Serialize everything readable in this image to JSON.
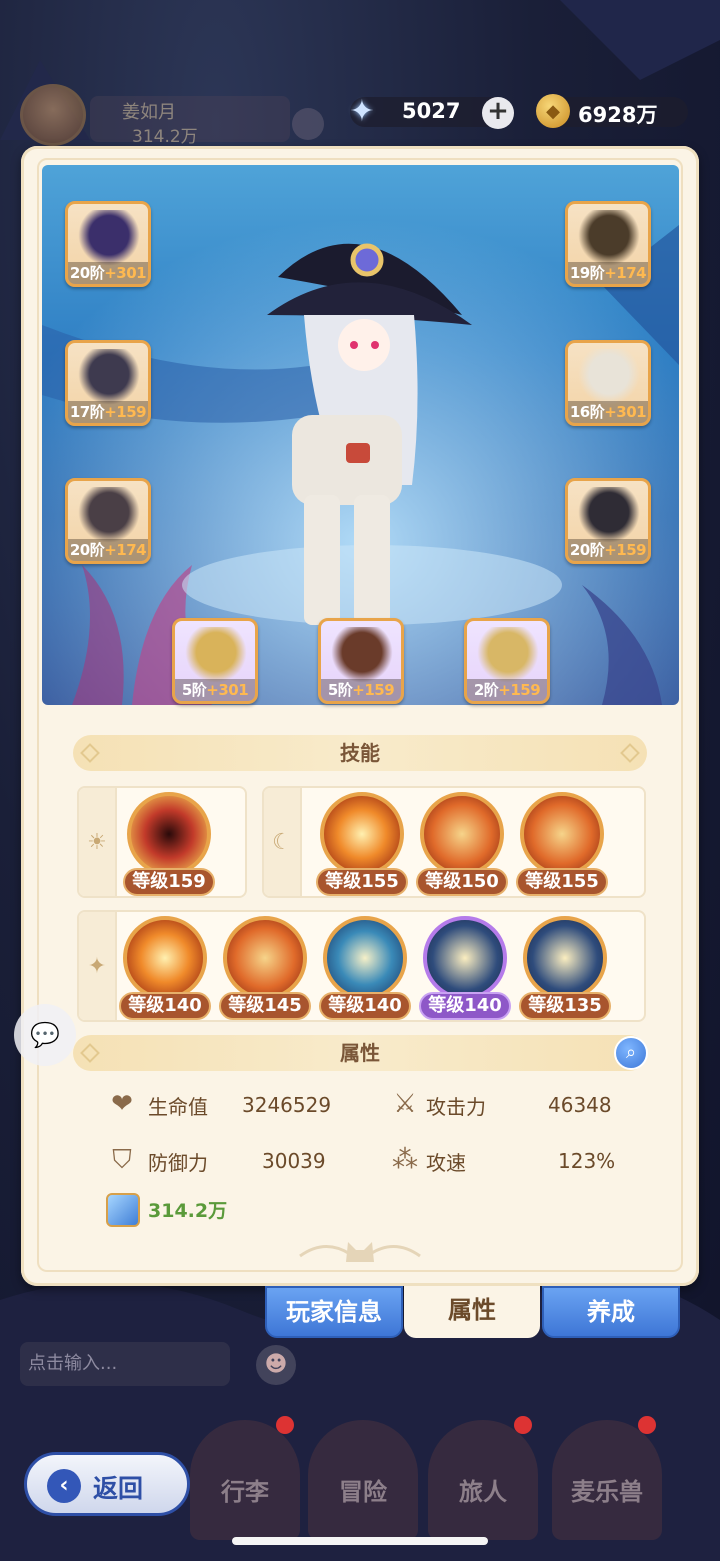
{
  "player": {
    "name": "姜如月",
    "power": "314.2万"
  },
  "currency": {
    "gems": "5027",
    "gold": "6928万"
  },
  "equipment": [
    {
      "slot": "helmet-left",
      "tier": "20阶",
      "plus": "+301"
    },
    {
      "slot": "armor",
      "tier": "17阶",
      "plus": "+159"
    },
    {
      "slot": "pants",
      "tier": "20阶",
      "plus": "+174"
    },
    {
      "slot": "helmet-right",
      "tier": "19阶",
      "plus": "+174"
    },
    {
      "slot": "gloves",
      "tier": "16阶",
      "plus": "+301"
    },
    {
      "slot": "boots",
      "tier": "20阶",
      "plus": "+159"
    },
    {
      "slot": "ring",
      "tier": "5阶",
      "plus": "+301"
    },
    {
      "slot": "necklace",
      "tier": "5阶",
      "plus": "+159"
    },
    {
      "slot": "charm",
      "tier": "2阶",
      "plus": "+159"
    }
  ],
  "skills_section": {
    "title": "技能"
  },
  "skills": {
    "group1": [
      {
        "level": "等级159"
      }
    ],
    "group2": [
      {
        "level": "等级155"
      },
      {
        "level": "等级150"
      },
      {
        "level": "等级155"
      }
    ],
    "group3": [
      {
        "level": "等级140"
      },
      {
        "level": "等级145"
      },
      {
        "level": "等级140"
      },
      {
        "level": "等级140"
      },
      {
        "level": "等级135"
      }
    ]
  },
  "attributes_section": {
    "title": "属性"
  },
  "attributes": {
    "hp": {
      "label": "生命值",
      "value": "3246529"
    },
    "attack": {
      "label": "攻击力",
      "value": "46348"
    },
    "defense": {
      "label": "防御力",
      "value": "30039"
    },
    "attack_speed": {
      "label": "攻速",
      "value": "123%"
    },
    "power": "314.2万"
  },
  "tabs": {
    "player_info": "玩家信息",
    "attributes": "属性",
    "cultivate": "养成"
  },
  "chat": {
    "placeholder": "点击输入..."
  },
  "nav": {
    "back": "返回",
    "bag": "行李",
    "adventure": "冒险",
    "traveler": "旅人",
    "pet": "麦乐兽"
  },
  "colors": {
    "panel": "#fbf4e6",
    "accent": "#e8a44a",
    "tab_blue": "#3e76d6",
    "level_badge": "#a8552e",
    "level_badge_purple": "#8e58c8",
    "power_green": "#5a9a3a"
  }
}
